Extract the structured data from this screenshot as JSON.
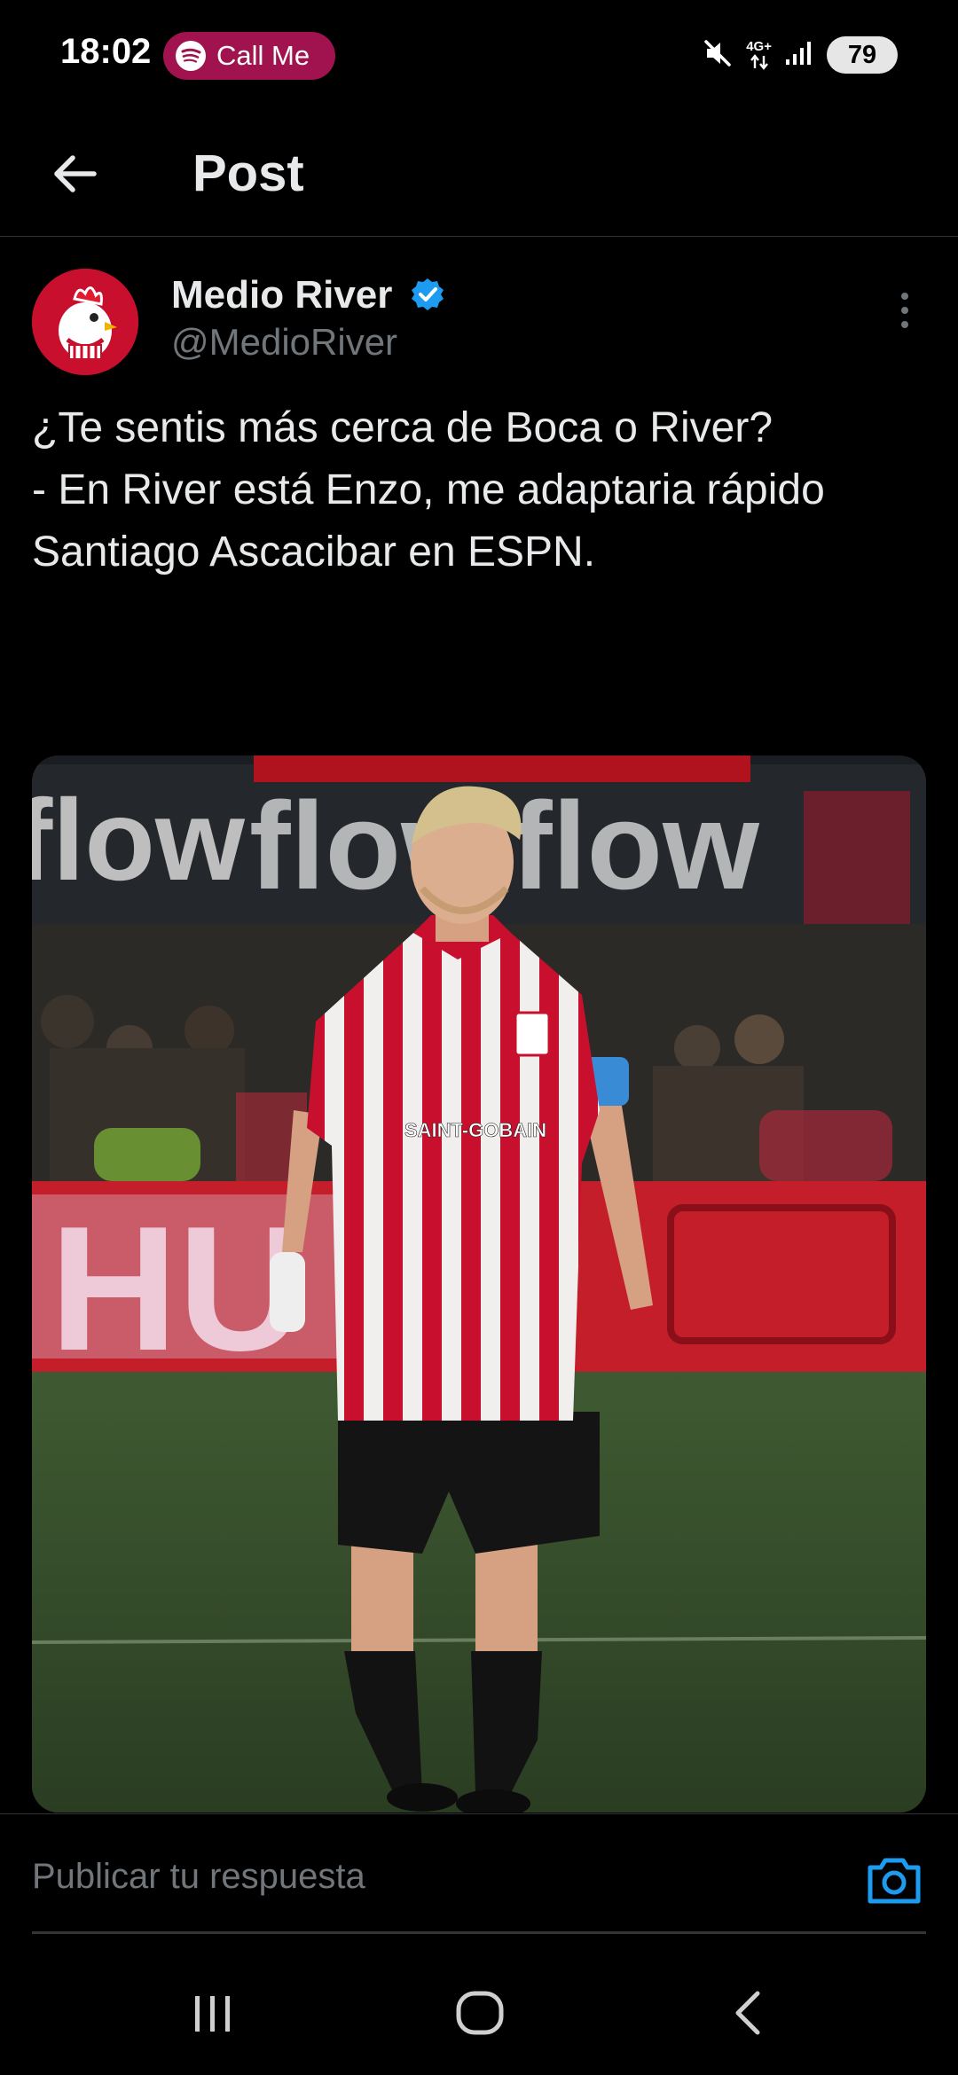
{
  "status_bar": {
    "time": "18:02",
    "call_chip_label": "Call Me",
    "network_label_top": "4G+",
    "battery_level": "79",
    "icons": [
      "spotify-icon",
      "mute-icon",
      "network-icon",
      "signal-icon",
      "battery-icon"
    ]
  },
  "header": {
    "title": "Post",
    "back_icon": "back-arrow-icon"
  },
  "post": {
    "author_name": "Medio River",
    "author_handle": "@MedioRiver",
    "verified": true,
    "text_lines": [
      "¿Te sentis más cerca de Boca o River?",
      "- En River está Enzo, me adaptaria rápido",
      "",
      "Santiago Ascacibar en ESPN."
    ],
    "image": {
      "shirt_sponsor": "SAINT-GOBAIN",
      "board_text": "flow"
    }
  },
  "reply_bar": {
    "placeholder": "Publicar tu respuesta",
    "camera_icon": "camera-icon"
  },
  "nav_bar": {
    "icons": [
      "recent-apps-icon",
      "home-icon",
      "back-icon"
    ]
  },
  "colors": {
    "background": "#000000",
    "text": "#e7e9ea",
    "secondary": "#71767b",
    "accent": "#1d9bf0",
    "call_chip": "#a0134f"
  }
}
